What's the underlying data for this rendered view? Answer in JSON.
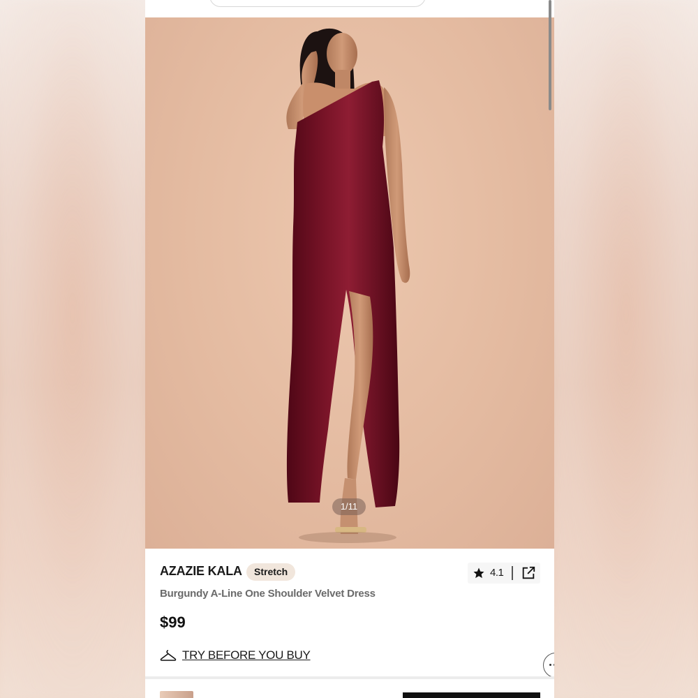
{
  "hero": {
    "image_counter": "1/11",
    "product_image_alt": "Model wearing a burgundy velvet one-shoulder gown"
  },
  "product": {
    "brand": "AZAZIE KALA",
    "badge": "Stretch",
    "name": "Burgundy A-Line One Shoulder Velvet Dress",
    "price": "$99",
    "rating": "4.1"
  },
  "try_on": {
    "label": "TRY BEFORE YOU BUY"
  },
  "icons": {
    "rating": "star-icon",
    "share": "share-icon",
    "try_on": "hanger-icon",
    "chat": "chat-icon"
  },
  "colors": {
    "dress": "#6e0f22",
    "background": "#e4bba1",
    "badge_bg": "#f1e6dc",
    "text": "#1a1a1a",
    "muted_text": "#6a6a6a"
  }
}
